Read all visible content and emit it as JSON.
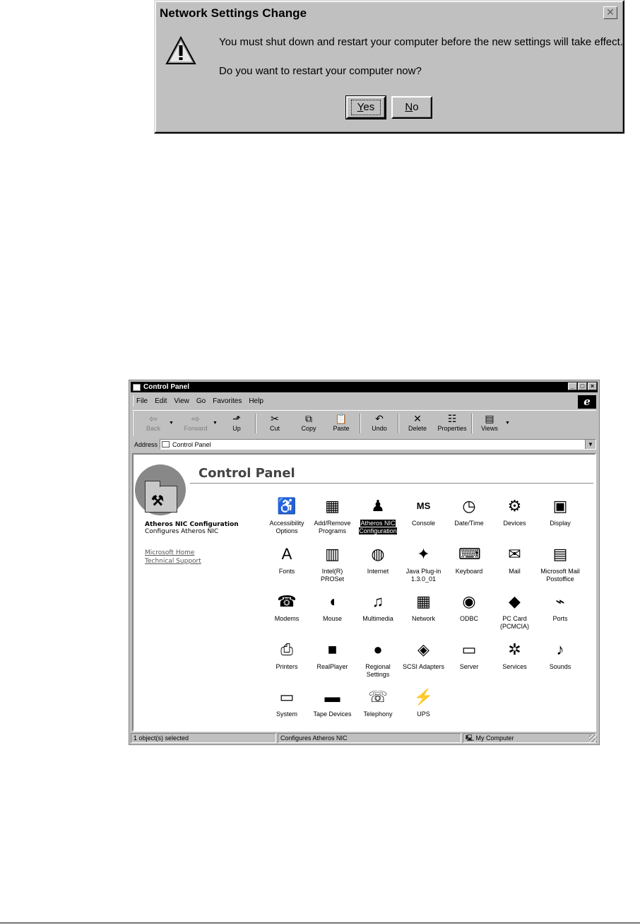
{
  "dialog": {
    "title": "Network Settings Change",
    "close_glyph": "✕",
    "message_line1": "You must shut down and restart your computer before the new settings will take effect.",
    "message_line2": "Do you want to restart your computer now?",
    "yes_mnemonic": "Y",
    "yes_rest": "es",
    "no_mnemonic": "N",
    "no_rest": "o"
  },
  "window": {
    "title": "Control Panel",
    "controls": {
      "minimize": "_",
      "maximize": "□",
      "close": "×"
    },
    "menu": [
      "File",
      "Edit",
      "View",
      "Go",
      "Favorites",
      "Help"
    ],
    "ie_logo": "e",
    "toolbar": {
      "back": "Back",
      "forward": "Forward",
      "up": "Up",
      "cut": "Cut",
      "copy": "Copy",
      "paste": "Paste",
      "undo": "Undo",
      "delete": "Delete",
      "properties": "Properties",
      "views": "Views"
    },
    "address_label": "Address",
    "address_value": "Control Panel",
    "heading": "Control Panel",
    "left_pane": {
      "title": "Atheros NIC Configuration",
      "description": "Configures Atheros NIC",
      "links": [
        "Microsoft Home",
        "Technical Support"
      ]
    },
    "icons": [
      {
        "label1": "Accessibility",
        "label2": "Options",
        "glyph": "♿",
        "icon": "accessibility-icon"
      },
      {
        "label1": "Add/Remove",
        "label2": "Programs",
        "glyph": "▦",
        "icon": "add-remove-programs-icon"
      },
      {
        "label1": "Atheros NIC",
        "label2": "Configuration",
        "glyph": "♟",
        "icon": "atheros-nic-icon",
        "selected": true
      },
      {
        "label1": "Console",
        "label2": "",
        "glyph": "MS",
        "icon": "console-icon"
      },
      {
        "label1": "Date/Time",
        "label2": "",
        "glyph": "◷",
        "icon": "date-time-icon"
      },
      {
        "label1": "Devices",
        "label2": "",
        "glyph": "⚙",
        "icon": "devices-icon"
      },
      {
        "label1": "Display",
        "label2": "",
        "glyph": "▣",
        "icon": "display-icon"
      },
      {
        "label1": "Fonts",
        "label2": "",
        "glyph": "A",
        "icon": "fonts-icon"
      },
      {
        "label1": "Intel(R)",
        "label2": "PROSet",
        "glyph": "▥",
        "icon": "intel-proset-icon"
      },
      {
        "label1": "Internet",
        "label2": "",
        "glyph": "◍",
        "icon": "internet-icon"
      },
      {
        "label1": "Java Plug-in",
        "label2": "1.3.0_01",
        "glyph": "✦",
        "icon": "java-plugin-icon"
      },
      {
        "label1": "Keyboard",
        "label2": "",
        "glyph": "⌨",
        "icon": "keyboard-icon"
      },
      {
        "label1": "Mail",
        "label2": "",
        "glyph": "✉",
        "icon": "mail-icon"
      },
      {
        "label1": "Microsoft Mail",
        "label2": "Postoffice",
        "glyph": "▤",
        "icon": "microsoft-mail-icon"
      },
      {
        "label1": "Modems",
        "label2": "",
        "glyph": "☎",
        "icon": "modems-icon"
      },
      {
        "label1": "Mouse",
        "label2": "",
        "glyph": "◖",
        "icon": "mouse-icon"
      },
      {
        "label1": "Multimedia",
        "label2": "",
        "glyph": "♫",
        "icon": "multimedia-icon"
      },
      {
        "label1": "Network",
        "label2": "",
        "glyph": "▦",
        "icon": "network-icon"
      },
      {
        "label1": "ODBC",
        "label2": "",
        "glyph": "◉",
        "icon": "odbc-icon"
      },
      {
        "label1": "PC Card",
        "label2": "(PCMCIA)",
        "glyph": "◆",
        "icon": "pc-card-icon"
      },
      {
        "label1": "Ports",
        "label2": "",
        "glyph": "⌁",
        "icon": "ports-icon"
      },
      {
        "label1": "Printers",
        "label2": "",
        "glyph": "⎙",
        "icon": "printers-icon"
      },
      {
        "label1": "RealPlayer",
        "label2": "",
        "glyph": "■",
        "icon": "realplayer-icon"
      },
      {
        "label1": "Regional",
        "label2": "Settings",
        "glyph": "●",
        "icon": "regional-settings-icon"
      },
      {
        "label1": "SCSI Adapters",
        "label2": "",
        "glyph": "◈",
        "icon": "scsi-adapters-icon"
      },
      {
        "label1": "Server",
        "label2": "",
        "glyph": "▭",
        "icon": "server-icon"
      },
      {
        "label1": "Services",
        "label2": "",
        "glyph": "✲",
        "icon": "services-icon"
      },
      {
        "label1": "Sounds",
        "label2": "",
        "glyph": "♪",
        "icon": "sounds-icon"
      },
      {
        "label1": "System",
        "label2": "",
        "glyph": "▭",
        "icon": "system-icon"
      },
      {
        "label1": "Tape Devices",
        "label2": "",
        "glyph": "▬",
        "icon": "tape-devices-icon"
      },
      {
        "label1": "Telephony",
        "label2": "",
        "glyph": "☏",
        "icon": "telephony-icon"
      },
      {
        "label1": "UPS",
        "label2": "",
        "glyph": "⚡",
        "icon": "ups-icon"
      }
    ],
    "status": {
      "selection": "1 object(s) selected",
      "description": "Configures Atheros NIC",
      "zone": "My Computer"
    }
  }
}
